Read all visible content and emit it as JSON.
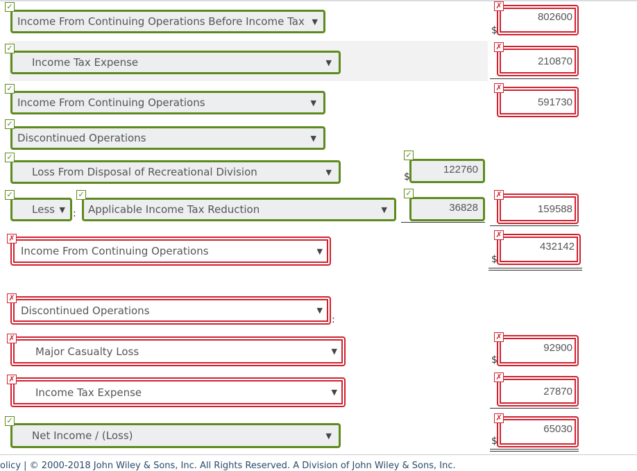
{
  "markers": {
    "correct": "✓",
    "incorrect": "✗"
  },
  "currency": "$",
  "rows": [
    {
      "label": "Income From Continuing Operations Before Income Tax",
      "label_status": "correct",
      "amount": "802600",
      "amount_status": "incorrect"
    },
    {
      "label": "Income Tax Expense",
      "label_status": "correct",
      "amount": "210870",
      "amount_status": "incorrect"
    },
    {
      "label": "Income From Continuing Operations",
      "label_status": "correct",
      "amount": "591730",
      "amount_status": "incorrect"
    },
    {
      "label": "Discontinued Operations",
      "label_status": "correct"
    },
    {
      "label": "Loss From Disposal of Recreational Division",
      "label_status": "correct",
      "amount": "122760",
      "amount_status": "correct"
    },
    {
      "prefix": "Less",
      "prefix_status": "correct",
      "label": "Applicable Income Tax Reduction",
      "label_status": "correct",
      "amount": "36828",
      "amount_status": "correct",
      "total": "159588",
      "total_status": "incorrect"
    },
    {
      "label": "Income From Continuing Operations",
      "label_status": "incorrect",
      "amount": "432142",
      "amount_status": "incorrect"
    },
    {
      "label": "Discontinued Operations",
      "label_status": "incorrect"
    },
    {
      "label": "Major Casualty Loss",
      "label_status": "incorrect",
      "amount": "92900",
      "amount_status": "incorrect"
    },
    {
      "label": "Income Tax Expense",
      "label_status": "incorrect",
      "amount": "27870",
      "amount_status": "incorrect"
    },
    {
      "label": "Net Income / (Loss)",
      "label_status": "correct",
      "amount": "65030",
      "amount_status": "incorrect"
    }
  ],
  "colon": ":",
  "dropdown_arrow": "▼",
  "footer": "olicy  |  © 2000-2018 John Wiley & Sons, Inc. All Rights Reserved. A Division of John Wiley & Sons, Inc."
}
